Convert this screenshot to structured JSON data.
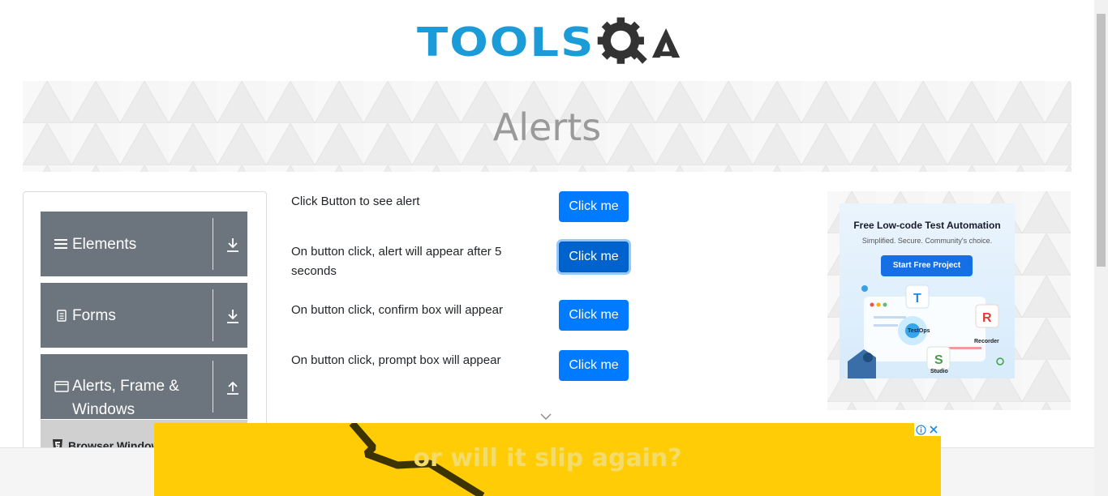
{
  "header": {
    "logo_text": "TOOLS",
    "logo_suffix": "QA"
  },
  "banner": {
    "title": "Alerts"
  },
  "menu": {
    "groups": [
      {
        "label": "Elements",
        "icon": "hamburger-icon",
        "arrow": "download-icon"
      },
      {
        "label": "Forms",
        "icon": "document-icon",
        "arrow": "download-icon"
      },
      {
        "label": "Alerts, Frame & Windows",
        "icon": "window-icon",
        "arrow": "upload-icon"
      }
    ],
    "sub_item": {
      "label": "Browser Windows",
      "icon": "html5-icon"
    }
  },
  "alerts": {
    "rows": [
      {
        "text": "Click Button to see alert",
        "button": "Click me"
      },
      {
        "text": "On button click, alert will appear after 5 seconds",
        "button": "Click me"
      },
      {
        "text": "On button click, confirm box will appear",
        "button": "Click me"
      },
      {
        "text": "On button click, prompt box will appear",
        "button": "Click me"
      }
    ]
  },
  "side_ad": {
    "title": "Free Low-code Test Automation",
    "subtitle": "Simplified. Secure. Community's choice.",
    "cta": "Start Free Project",
    "labels": {
      "testops": "TestOps",
      "recorder": "Recorder",
      "studio": "Studio"
    }
  },
  "bottom_ad": {
    "text": "or will it slip again?"
  },
  "colors": {
    "primary": "#007bff",
    "menu_group": "#6c757d",
    "logo_blue": "#1b9cd8",
    "logo_dark": "#333333",
    "ad_yellow": "#ffcc05"
  }
}
